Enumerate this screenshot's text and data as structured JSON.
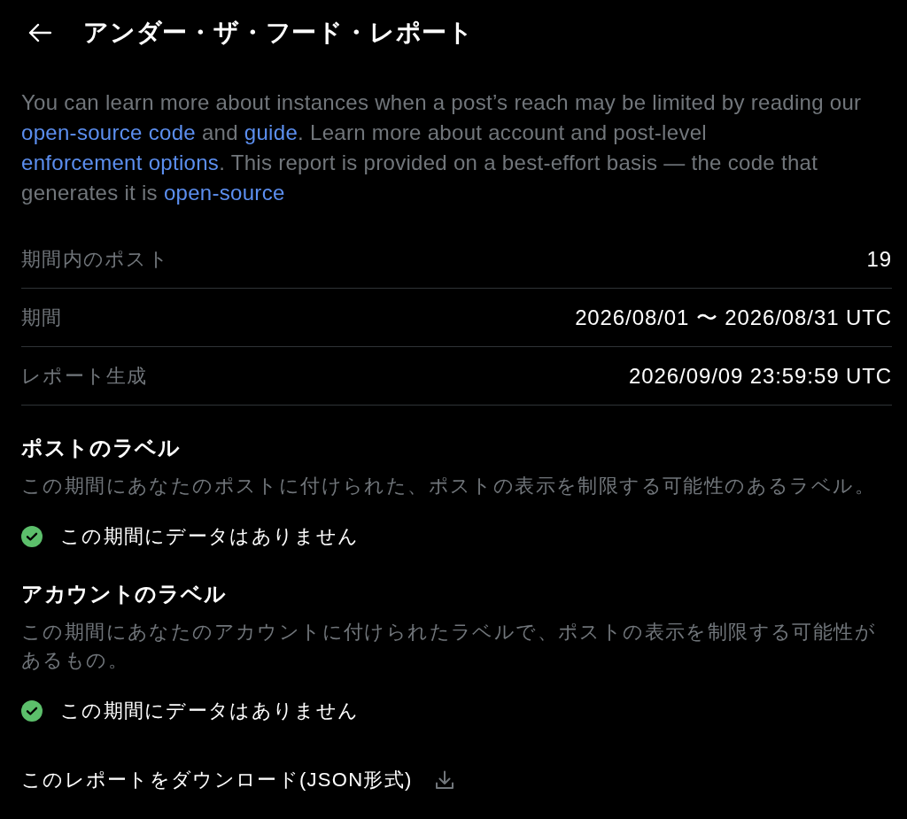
{
  "header": {
    "title": "アンダー・ザ・フード・レポート"
  },
  "intro": [
    {
      "kind": "text",
      "text": "You can learn more about instances when a post’s reach may be limited by reading our "
    },
    {
      "kind": "link",
      "text": "open-source code"
    },
    {
      "kind": "text",
      "text": " and "
    },
    {
      "kind": "link",
      "text": "guide"
    },
    {
      "kind": "text",
      "text": ". Learn more about account and post-level "
    },
    {
      "kind": "link",
      "text": "enforcement options"
    },
    {
      "kind": "text",
      "text": ". This report is provided on a best-effort basis — the code that generates it is "
    },
    {
      "kind": "link",
      "text": "open-source"
    }
  ],
  "summary": [
    {
      "label": "期間内のポスト",
      "value": "19"
    },
    {
      "label": "期間",
      "value": "2026/08/01 〜 2026/08/31 UTC"
    },
    {
      "label": "レポート生成",
      "value": "2026/09/09 23:59:59 UTC"
    }
  ],
  "sections": [
    {
      "title": "ポストのラベル",
      "description": "この期間にあなたのポストに付けられた、ポストの表示を制限する可能性のあるラベル。",
      "status": "この期間にデータはありません"
    },
    {
      "title": "アカウントのラベル",
      "description": "この期間にあなたのアカウントに付けられたラベルで、ポストの表示を制限する可能性があるもの。",
      "status": "この期間にデータはありません"
    }
  ],
  "download": {
    "label": "このレポートをダウンロード(JSON形式)"
  }
}
